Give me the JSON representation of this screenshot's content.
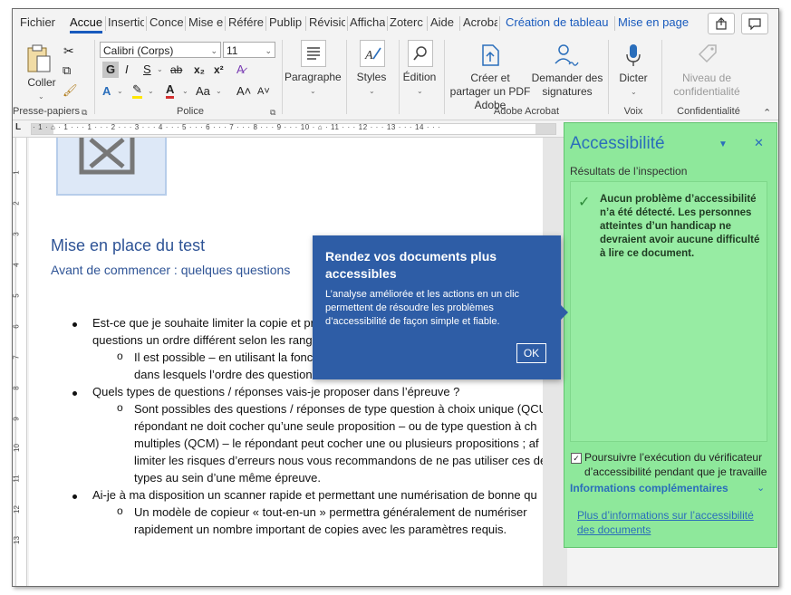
{
  "tabs": [
    {
      "label": "Fichier"
    },
    {
      "label": "Accue"
    },
    {
      "label": "Insertio"
    },
    {
      "label": "Concep"
    },
    {
      "label": "Mise en"
    },
    {
      "label": "Référe"
    },
    {
      "label": "Publip"
    },
    {
      "label": "Révisio"
    },
    {
      "label": "Afficha"
    },
    {
      "label": "Zoterc"
    },
    {
      "label": "Aide"
    },
    {
      "label": "Acroba"
    },
    {
      "label": "Création de tableau"
    },
    {
      "label": "Mise en page"
    }
  ],
  "ribbon": {
    "paste_label": "Coller",
    "clipboard_label": "Presse-papiers",
    "font_name": "Calibri (Corps)",
    "font_size": "11",
    "font_group_label": "Police",
    "bold": "G",
    "italic": "I",
    "underline": "S",
    "strike": "ab",
    "subscript": "x₂",
    "superscript": "x²",
    "case": "Aa",
    "grow": "A˄",
    "shrink": "A˅",
    "paragraph_label": "Paragraphe",
    "styles_label": "Styles",
    "editing_label": "Édition",
    "create_pdf_label": "Créer et partager un PDF Adobe",
    "signatures_label": "Demander des signatures",
    "acrobat_group_label": "Adobe Acrobat",
    "dictate_label": "Dicter",
    "voice_group_label": "Voix",
    "sensitivity_label": "Niveau de confidentialité",
    "confidential_group_label": "Confidentialité"
  },
  "ruler": {
    "h": "· 1 · ⌂ · 1 · · · 1 · · · 2 · · · 3 · · · 4 · · · 5 · · · 6 · · · 7 · · · 8 · · · 9 · · · 10 · ⌂ · 11 · · · 12 · · · 13 · · · 14 · · ·",
    "v": [
      "1",
      "2",
      "3",
      "4",
      "5",
      "6",
      "7",
      "8",
      "9",
      "10",
      "11",
      "12",
      "13"
    ]
  },
  "doc": {
    "heading1": "Mise en place du test",
    "heading2": "Avant de commencer : quelques questions",
    "lines": [
      "Est-ce que je souhaite limiter la copie et pr",
      "questions un ordre différent selon les rang",
      "Il est possible – en utilisant la fonc",
      "dans lesquels l’ordre des question",
      "Quels types de questions / réponses vais-je proposer dans l’épreuve ?",
      "Sont possibles des questions / réponses de type question à choix unique (QCU",
      "répondant ne doit cocher qu’une seule proposition – ou de type question à ch",
      "multiples (QCM) – le répondant peut cocher une ou plusieurs propositions ; af",
      "limiter les risques d’erreurs nous vous recommandons de ne pas utiliser ces de",
      "types au sein d’une même épreuve.",
      "Ai-je à ma disposition un scanner rapide et permettant une numérisation de bonne qu",
      "Un modèle de copieur « tout-en-un » permettra généralement de numériser",
      "rapidement un nombre important de copies avec les paramètres requis."
    ]
  },
  "popup": {
    "title": "Rendez vos documents plus accessibles",
    "body": "L’analyse améliorée et les actions en un clic permettent de résoudre les problèmes d’accessibilité de façon simple et fiable.",
    "ok": "OK"
  },
  "pane": {
    "title": "Accessibilité",
    "subtitle": "Résultats de l’inspection",
    "result": "Aucun problème d’accessibilité n’a été détecté. Les personnes atteintes d’un handicap ne devraient avoir aucune difficulté à lire ce document.",
    "checkbox": "Poursuivre l’exécution du vérificateur d’accessibilité pendant que je travaille",
    "more_info": "Informations complémentaires",
    "link": "Plus d’informations sur l’accessibilité des documents"
  },
  "colors": {
    "accent": "#185abd",
    "popup": "#2e5da6",
    "pane": "#8ee89b",
    "heading": "#2f5496"
  }
}
